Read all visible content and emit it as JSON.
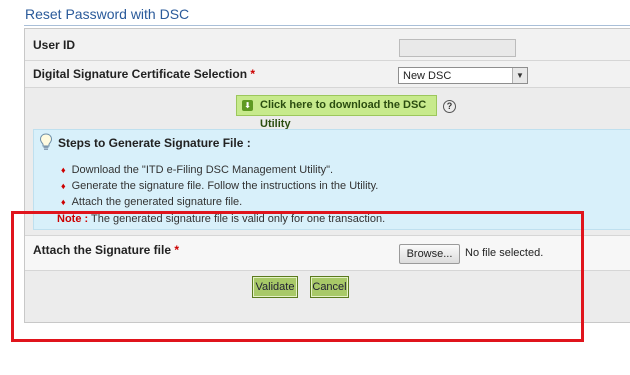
{
  "header": {
    "title": "Reset Password with DSC"
  },
  "form": {
    "user_id_label": "User ID",
    "dsc_label": "Digital Signature Certificate Selection",
    "required_marker": "*",
    "dsc_selected": "New DSC",
    "download_button": "Click here to download the DSC Utility",
    "help_icon": "?"
  },
  "steps": {
    "title": "Steps to Generate Signature File :",
    "items": [
      "Download the \"ITD e-Filing DSC Management Utility\".",
      "Generate the signature file. Follow the instructions in the Utility.",
      "Attach the generated signature file."
    ],
    "note_label": "Note :",
    "note_text": "The generated signature file is valid only for one transaction."
  },
  "attach": {
    "label": "Attach the Signature file",
    "browse_button": "Browse...",
    "file_status": "No file selected."
  },
  "actions": {
    "validate": "Validate",
    "cancel": "Cancel"
  },
  "colors": {
    "accent": "#2a5a9a",
    "highlight_box": "#e0141c",
    "info_bg": "#d8f0fa",
    "button_green": "#a8c968"
  },
  "icons": {
    "download": "download-icon",
    "help": "help-icon",
    "tip": "lightbulb-icon",
    "bullet": "bullet-icon",
    "dropdown": "chevron-down-icon"
  }
}
